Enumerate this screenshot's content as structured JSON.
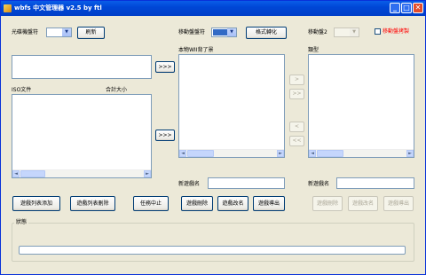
{
  "window": {
    "title": "wbfs 中文管理器 v2.5 by ftl"
  },
  "drive_row": {
    "optical_label": "光碟機盤符",
    "refresh_button": "刷新",
    "mobile_label": "移動盤盤符",
    "format_button": "格式轉化",
    "mobile2_label": "移動盤2",
    "copy_checkbox_label": "移動盤拷製"
  },
  "left_panel": {
    "iso_header": "ISO文件",
    "total_size_header": "合計大小",
    "add_list_button": "遊戲列表添加",
    "delete_list_button": "遊戲列表刪除",
    "stop_task_button": "任務中止"
  },
  "mid_panel": {
    "header": "本物WII背了景",
    "new_name_label": "新遊戲名",
    "delete_button": "遊戲刪除",
    "rename_button": "遊戲改名",
    "export_button": "遊戲導出",
    "transfer_arrow": ">>>"
  },
  "right_panel": {
    "header": "類型",
    "new_name_label": "新遊戲名",
    "delete_button": "遊戲刪除",
    "rename_button": "遊戲改名",
    "export_button": "遊戲導出",
    "arrows": [
      ">",
      ">>",
      "<",
      "<<"
    ]
  },
  "status": {
    "label": "狀態",
    "progress_fraction": 0.0
  },
  "colors": {
    "progress_fill": "#2dd33a",
    "checkbox_label": "#ff0000",
    "mobile_combo_value": "#316ac5"
  }
}
